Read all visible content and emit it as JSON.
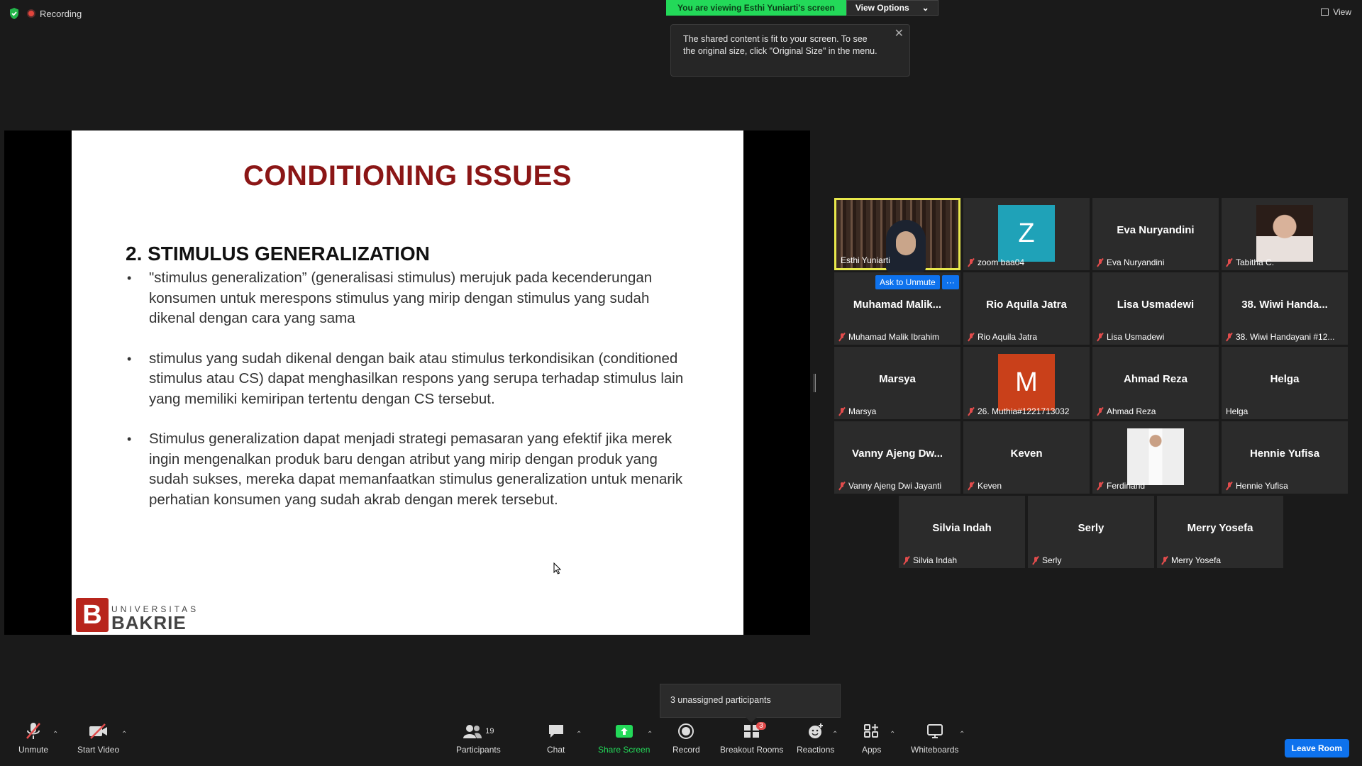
{
  "top": {
    "recording_label": "Recording",
    "viewing_label": "You are viewing Esthi Yuniarti's screen",
    "view_options_label": "View Options",
    "view_label": "View",
    "tooltip_text": "The shared content is fit to your screen. To see the original size, click \"Original Size\" in the menu."
  },
  "slide": {
    "title": "CONDITIONING ISSUES",
    "subtitle": "2.  STIMULUS GENERALIZATION",
    "bullets": [
      "\"stimulus generalization” (generalisasi stimulus) merujuk pada kecenderungan konsumen untuk merespons stimulus yang mirip dengan stimulus yang sudah dikenal dengan cara yang sama",
      "stimulus yang sudah dikenal dengan baik atau stimulus terkondisikan (conditioned stimulus atau CS) dapat menghasilkan respons yang serupa terhadap stimulus lain yang memiliki kemiripan tertentu dengan CS tersebut.",
      "Stimulus generalization dapat menjadi strategi pemasaran yang efektif jika merek ingin mengenalkan produk baru dengan atribut yang mirip dengan produk yang sudah sukses, mereka dapat memanfaatkan stimulus generalization untuk menarik perhatian konsumen yang sudah akrab dengan merek tersebut."
    ],
    "logo_line1": "UNIVERSITAS",
    "logo_line2": "BAKRIE",
    "logo_letter": "B"
  },
  "gallery": {
    "ask_unmute": "Ask to Unmute",
    "more": "···",
    "tiles": [
      {
        "label": "Esthi Yuniarti",
        "center": "",
        "avatar": "",
        "avatar_color": "",
        "photo": "video",
        "muted": false
      },
      {
        "label": "zoom baa04",
        "center": "",
        "avatar": "Z",
        "avatar_color": "#1fa2b8",
        "photo": "",
        "muted": true
      },
      {
        "label": "Eva Nuryandini",
        "center": "Eva Nuryandini",
        "avatar": "",
        "avatar_color": "",
        "photo": "",
        "muted": true
      },
      {
        "label": "Tabitha C.",
        "center": "",
        "avatar": "",
        "avatar_color": "",
        "photo": "portrait",
        "muted": true
      },
      {
        "label": "Muhamad Malik Ibrahim",
        "center": "Muhamad  Malik...",
        "avatar": "",
        "avatar_color": "",
        "photo": "",
        "muted": true
      },
      {
        "label": "Rio Aquila Jatra",
        "center": "Rio Aquila Jatra",
        "avatar": "",
        "avatar_color": "",
        "photo": "",
        "muted": true
      },
      {
        "label": "Lisa Usmadewi",
        "center": "Lisa Usmadewi",
        "avatar": "",
        "avatar_color": "",
        "photo": "",
        "muted": true
      },
      {
        "label": "38. Wiwi Handayani #12...",
        "center": "38. Wiwi Handa...",
        "avatar": "",
        "avatar_color": "",
        "photo": "",
        "muted": true
      },
      {
        "label": "Marsya",
        "center": "Marsya",
        "avatar": "",
        "avatar_color": "",
        "photo": "",
        "muted": true
      },
      {
        "label": "26. Muthia#1221713032",
        "center": "",
        "avatar": "M",
        "avatar_color": "#c9401a",
        "photo": "",
        "muted": true
      },
      {
        "label": "Ahmad Reza",
        "center": "Ahmad Reza",
        "avatar": "",
        "avatar_color": "",
        "photo": "",
        "muted": true
      },
      {
        "label": "Helga",
        "center": "Helga",
        "avatar": "",
        "avatar_color": "",
        "photo": "",
        "muted": false
      },
      {
        "label": "Vanny Ajeng Dwi Jayanti",
        "center": "Vanny  Ajeng  Dw...",
        "avatar": "",
        "avatar_color": "",
        "photo": "",
        "muted": true
      },
      {
        "label": "Keven",
        "center": "Keven",
        "avatar": "",
        "avatar_color": "",
        "photo": "",
        "muted": true
      },
      {
        "label": "Ferdinand",
        "center": "",
        "avatar": "",
        "avatar_color": "",
        "photo": "person",
        "muted": true
      },
      {
        "label": "Hennie Yufisa",
        "center": "Hennie Yufisa",
        "avatar": "",
        "avatar_color": "",
        "photo": "",
        "muted": true
      },
      {
        "label": "Silvia Indah",
        "center": "Silvia Indah",
        "avatar": "",
        "avatar_color": "",
        "photo": "",
        "muted": true
      },
      {
        "label": "Serly",
        "center": "Serly",
        "avatar": "",
        "avatar_color": "",
        "photo": "",
        "muted": true
      },
      {
        "label": "Merry Yosefa",
        "center": "Merry Yosefa",
        "avatar": "",
        "avatar_color": "",
        "photo": "",
        "muted": true
      }
    ]
  },
  "notice": "3 unassigned participants",
  "toolbar": {
    "unmute": "Unmute",
    "start_video": "Start Video",
    "participants": "Participants",
    "participants_count": "19",
    "chat": "Chat",
    "share_screen": "Share Screen",
    "record": "Record",
    "breakout_rooms": "Breakout Rooms",
    "breakout_badge": "3",
    "reactions": "Reactions",
    "apps": "Apps",
    "whiteboards": "Whiteboards",
    "leave": "Leave Room"
  },
  "colors": {
    "accent": "#0e72ed",
    "share_green": "#23d959",
    "slide_title": "#8b1616",
    "active_speaker": "#e8e84c"
  }
}
